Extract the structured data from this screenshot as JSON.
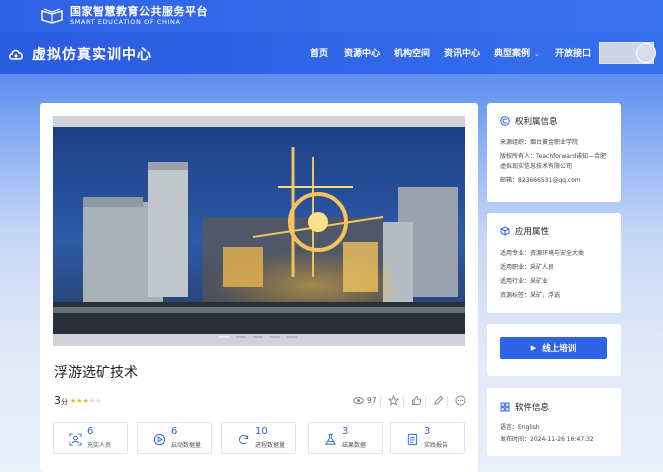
{
  "header": {
    "brand_cn": "国家智慧教育公共服务平台",
    "brand_en": "SMART EDUCATION OF CHINA",
    "site_title": "虚拟仿真实训中心",
    "nav": [
      {
        "label": "首页"
      },
      {
        "label": "资源中心"
      },
      {
        "label": "机构空间"
      },
      {
        "label": "资讯中心"
      },
      {
        "label": "典型案例"
      },
      {
        "label": "开放接口"
      }
    ],
    "colors": {
      "primary": "#2f63e4",
      "star": "#f5b321"
    }
  },
  "course": {
    "title": "浮游选矿技术",
    "score": "3",
    "score_unit": "分",
    "rating_stars": 3,
    "rating_max": 5,
    "views": "97",
    "slide_count": 5,
    "active_slide": 0
  },
  "stats": [
    {
      "value": "6",
      "label": "充实人员",
      "icon": "person-scan-icon"
    },
    {
      "value": "6",
      "label": "启动数据量",
      "icon": "play-circle-icon"
    },
    {
      "value": "10",
      "label": "进程数据量",
      "icon": "refresh-icon"
    },
    {
      "value": "3",
      "label": "结果数据",
      "icon": "flask-icon"
    },
    {
      "value": "3",
      "label": "实践报告",
      "icon": "report-icon"
    }
  ],
  "rights": {
    "heading": "权利属信息",
    "source_label": "来源组织：",
    "source_value": "烟台黄金职业学院",
    "owner_label": "版权所有人：",
    "owner_value_1": "Teachforward诺知—合肥",
    "owner_value_2": "虚拟现实信息技术有限公司",
    "email_label": "邮箱：",
    "email_value": "823666531@qq.com"
  },
  "attributes": {
    "heading": "应用属性",
    "rows": [
      {
        "k": "适用专业：",
        "v": "资源环境与安全大类"
      },
      {
        "k": "适用职业：",
        "v": "采矿人员"
      },
      {
        "k": "适用行业：",
        "v": "采矿业"
      },
      {
        "k": "资源标签：",
        "v": "采矿，浮选"
      }
    ]
  },
  "training": {
    "button_label": "线上培训"
  },
  "software": {
    "heading": "软件信息",
    "lang_label": "语言：",
    "lang_value": "English",
    "date_label": "发布时间：",
    "date_value": "2024-11-26 16:47:32"
  }
}
